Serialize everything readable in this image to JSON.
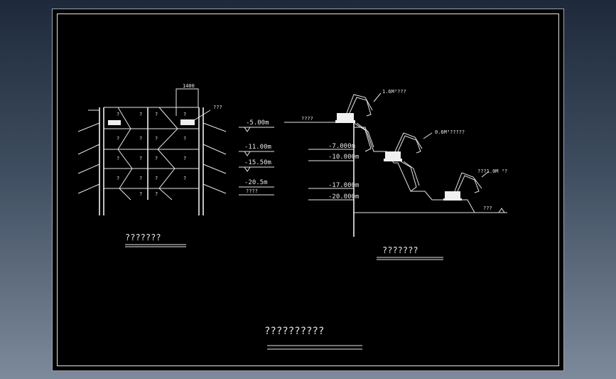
{
  "drawing": {
    "background": "#000000",
    "line_color": "#e8e8e8",
    "left_section": {
      "caption": "???????",
      "top_dim": "1400",
      "callout": "???",
      "cell_marks": [
        "?",
        "?",
        "?",
        "?",
        "?",
        "?",
        "?",
        "?",
        "?",
        "?",
        "?",
        "?",
        "?",
        "?",
        "?",
        "?",
        "?",
        "?",
        "?",
        "?"
      ]
    },
    "elevations": [
      "-5.00m",
      "-11.00m",
      "-15.50m",
      "-20.5m"
    ],
    "elevation_note": "????",
    "right_section": {
      "caption": "???????",
      "ground_label": "????",
      "bottom_label": "???",
      "levels": [
        "-7.000m",
        "-10.000m",
        "-17.000m",
        "-20.000m"
      ],
      "excavators": [
        "1.6M³???",
        "0.6M³?????",
        "???1.0M ³?"
      ]
    },
    "title": "??????????"
  }
}
